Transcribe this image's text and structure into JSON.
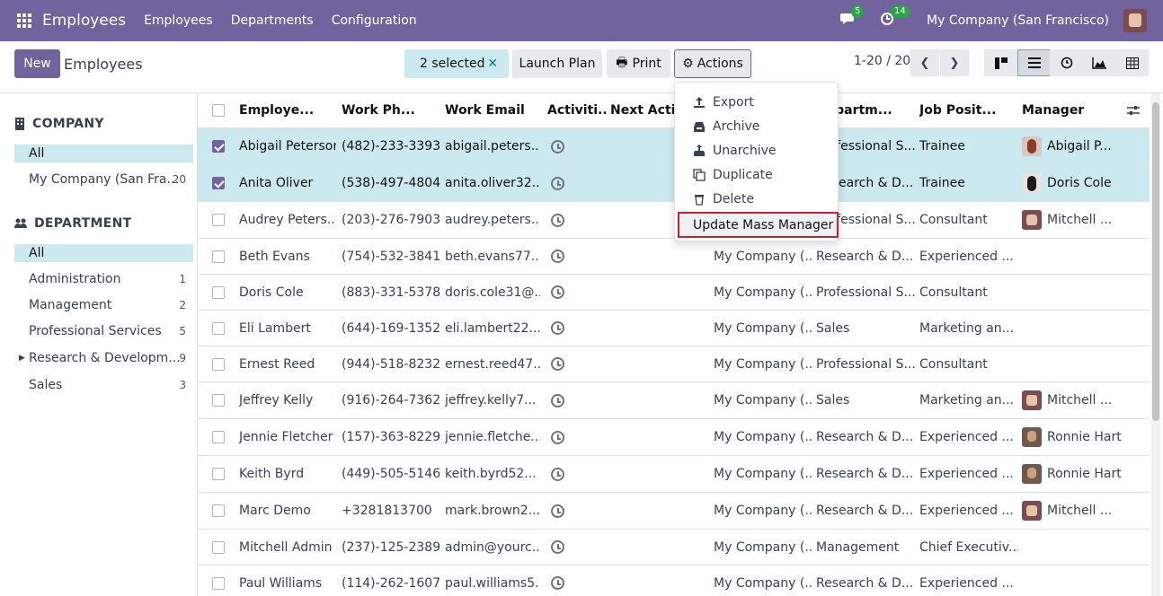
{
  "topbar": {
    "app_title": "Employees",
    "menu": [
      "Employees",
      "Departments",
      "Configuration"
    ],
    "messages_count": "5",
    "activities_count": "14",
    "company": "My Company (San Francisco)"
  },
  "control": {
    "new_label": "New",
    "breadcrumb": "Employees",
    "selected_label": "2 selected",
    "launch_plan_label": "Launch Plan",
    "print_label": "Print",
    "actions_label": "Actions",
    "pager": "1-20 / 20"
  },
  "sidebar": {
    "company_heading": "COMPANY",
    "company_items": [
      {
        "label": "All",
        "count": ""
      },
      {
        "label": "My Company (San Fra...",
        "count": "20"
      }
    ],
    "department_heading": "DEPARTMENT",
    "department_items": [
      {
        "label": "All",
        "count": ""
      },
      {
        "label": "Administration",
        "count": "1"
      },
      {
        "label": "Management",
        "count": "2"
      },
      {
        "label": "Professional Services",
        "count": "5"
      },
      {
        "label": "Research & Developm...",
        "count": "9"
      },
      {
        "label": "Sales",
        "count": "3"
      }
    ]
  },
  "table": {
    "columns": [
      "Employe...",
      "Work Ph...",
      "Work Email",
      "Activiti...",
      "Next Acti...",
      "",
      "Departm...",
      "Job Posit...",
      "Manager"
    ],
    "rows": [
      {
        "name": "Abigail Peterson",
        "phone": "(482)-233-3393",
        "email": "abigail.peters...",
        "company": "",
        "dept": "Professional S...",
        "job": "Trainee",
        "manager": "Abigail P...",
        "avatar": "abigail",
        "selected": true
      },
      {
        "name": "Anita Oliver",
        "phone": "(538)-497-4804",
        "email": "anita.oliver32...",
        "company": "",
        "dept": "Research & D...",
        "job": "Trainee",
        "manager": "Doris Cole",
        "avatar": "doris",
        "selected": true
      },
      {
        "name": "Audrey Peters...",
        "phone": "(203)-276-7903",
        "email": "audrey.peters...",
        "company": "",
        "dept": "Professional S...",
        "job": "Consultant",
        "manager": "Mitchell ...",
        "avatar": "mitchell",
        "selected": false
      },
      {
        "name": "Beth Evans",
        "phone": "(754)-532-3841",
        "email": "beth.evans77...",
        "company": "My Company (...",
        "dept": "Research & D...",
        "job": "Experienced ...",
        "manager": "",
        "avatar": "",
        "selected": false
      },
      {
        "name": "Doris Cole",
        "phone": "(883)-331-5378",
        "email": "doris.cole31@...",
        "company": "My Company (...",
        "dept": "Professional S...",
        "job": "Consultant",
        "manager": "",
        "avatar": "",
        "selected": false
      },
      {
        "name": "Eli Lambert",
        "phone": "(644)-169-1352",
        "email": "eli.lambert22...",
        "company": "My Company (...",
        "dept": "Sales",
        "job": "Marketing an...",
        "manager": "",
        "avatar": "",
        "selected": false
      },
      {
        "name": "Ernest Reed",
        "phone": "(944)-518-8232",
        "email": "ernest.reed47...",
        "company": "My Company (...",
        "dept": "Professional S...",
        "job": "Consultant",
        "manager": "",
        "avatar": "",
        "selected": false
      },
      {
        "name": "Jeffrey Kelly",
        "phone": "(916)-264-7362",
        "email": "jeffrey.kelly7...",
        "company": "My Company (...",
        "dept": "Sales",
        "job": "Marketing an...",
        "manager": "Mitchell ...",
        "avatar": "mitchell",
        "selected": false
      },
      {
        "name": "Jennie Fletcher",
        "phone": "(157)-363-8229",
        "email": "jennie.fletche...",
        "company": "My Company (...",
        "dept": "Research & D...",
        "job": "Experienced ...",
        "manager": "Ronnie Hart",
        "avatar": "ronnie",
        "selected": false
      },
      {
        "name": "Keith Byrd",
        "phone": "(449)-505-5146",
        "email": "keith.byrd52...",
        "company": "My Company (...",
        "dept": "Research & D...",
        "job": "Experienced ...",
        "manager": "Ronnie Hart",
        "avatar": "ronnie",
        "selected": false
      },
      {
        "name": "Marc Demo",
        "phone": "+3281813700",
        "email": "mark.brown2...",
        "company": "My Company (...",
        "dept": "Research & D...",
        "job": "Experienced ...",
        "manager": "Mitchell ...",
        "avatar": "mitchell",
        "selected": false
      },
      {
        "name": "Mitchell Admin",
        "phone": "(237)-125-2389",
        "email": "admin@yourc...",
        "company": "My Company (...",
        "dept": "Management",
        "job": "Chief Executiv...",
        "manager": "",
        "avatar": "",
        "selected": false
      },
      {
        "name": "Paul Williams",
        "phone": "(114)-262-1607",
        "email": "paul.williams5...",
        "company": "My Company (...",
        "dept": "Research & D...",
        "job": "Experienced ...",
        "manager": "",
        "avatar": "",
        "selected": false
      }
    ]
  },
  "actions_menu": {
    "items": [
      "Export",
      "Archive",
      "Unarchive",
      "Duplicate",
      "Delete"
    ],
    "highlighted": "Update Mass Manager"
  },
  "colors": {
    "brand": "#71639e",
    "selected_row": "#cde9f0",
    "highlight_border": "#c82333",
    "badge": "#28a745"
  }
}
